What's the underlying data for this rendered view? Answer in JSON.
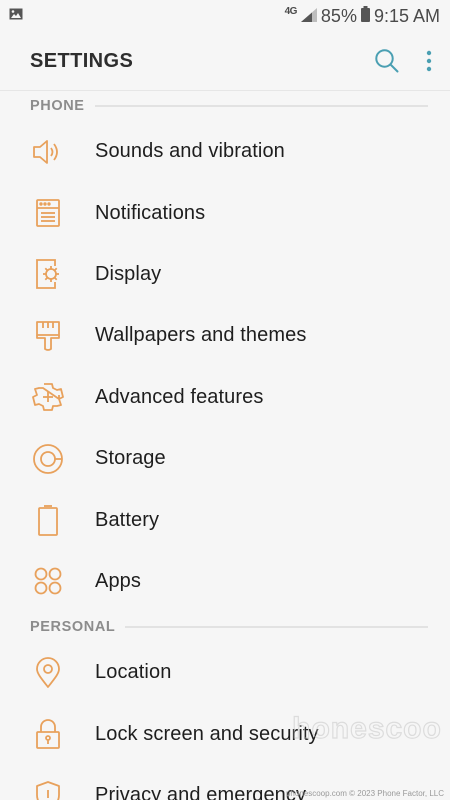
{
  "status_bar": {
    "gallery_icon": "image-icon",
    "network": "4G",
    "battery_percent": "85%",
    "time": "9:15 AM"
  },
  "app_bar": {
    "title": "SETTINGS",
    "search_icon": "search-icon",
    "more_icon": "more-vert-icon"
  },
  "sections": [
    {
      "label": "PHONE",
      "items": [
        {
          "label": "Sounds and vibration",
          "icon": "volume-icon"
        },
        {
          "label": "Notifications",
          "icon": "notifications-icon"
        },
        {
          "label": "Display",
          "icon": "display-icon"
        },
        {
          "label": "Wallpapers and themes",
          "icon": "brush-icon"
        },
        {
          "label": "Advanced features",
          "icon": "advanced-features-icon"
        },
        {
          "label": "Storage",
          "icon": "storage-icon"
        },
        {
          "label": "Battery",
          "icon": "battery-icon"
        },
        {
          "label": "Apps",
          "icon": "apps-icon"
        }
      ]
    },
    {
      "label": "PERSONAL",
      "items": [
        {
          "label": "Location",
          "icon": "location-icon"
        },
        {
          "label": "Lock screen and security",
          "icon": "lock-icon"
        },
        {
          "label": "Privacy and emergency",
          "icon": "privacy-icon"
        }
      ]
    }
  ],
  "watermark": {
    "text": "phonescoop",
    "site": "phonescoop.com",
    "copyright": "© 2023 Phone Factor, LLC"
  },
  "colors": {
    "accent_icon": "#e8a15c",
    "action_icon": "#4a9fb2",
    "background": "#f6f6f6"
  }
}
